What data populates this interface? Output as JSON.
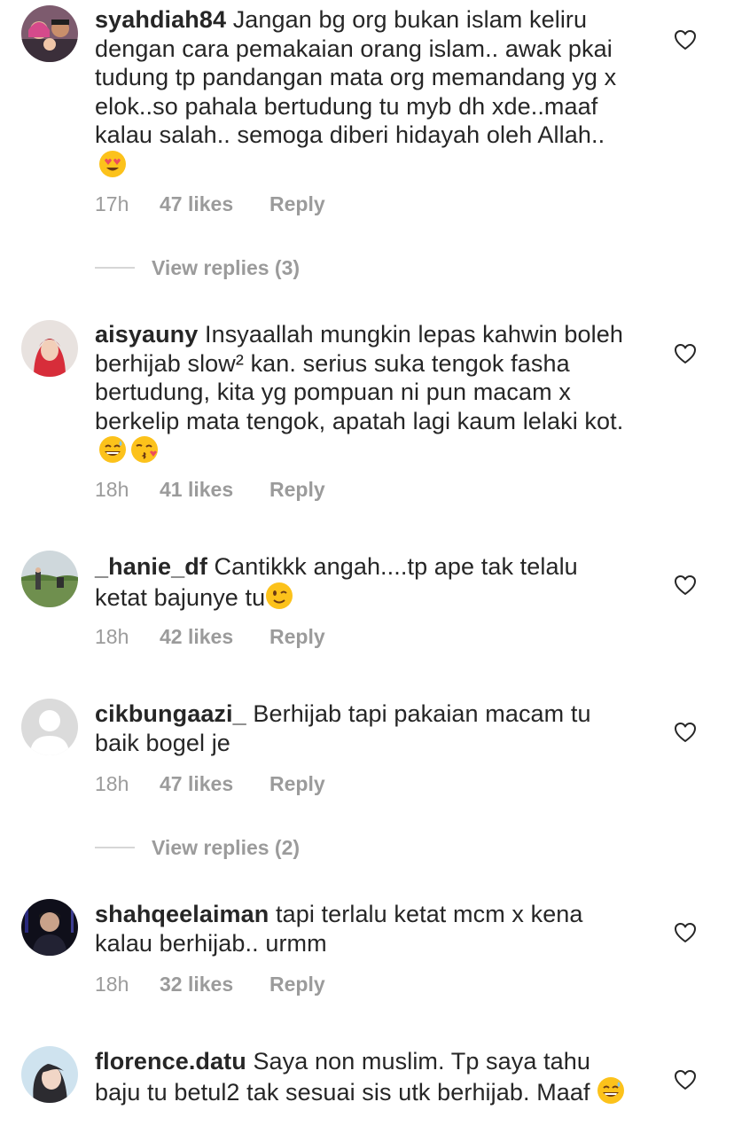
{
  "comments": [
    {
      "username": "syahdiah84",
      "text": "Jangan bg org bukan islam keliru dengan cara pemakaian orang islam.. awak pkai tudung tp pandangan mata org memandang yg x elok..so pahala bertudung tu myb dh xde..maaf kalau salah.. semoga diberi hidayah oleh Allah..",
      "emojis": [
        "😍"
      ],
      "time": "17h",
      "likes": "47 likes",
      "reply": "Reply",
      "view_replies": "View replies (3)"
    },
    {
      "username": "aisyauny",
      "text": "Insyaallah mungkin lepas kahwin boleh berhijab slow² kan. serius suka tengok fasha bertudung, kita yg pompuan ni pun macam x berkelip mata tengok, apatah lagi kaum lelaki kot.",
      "emojis": [
        "😅",
        "😘"
      ],
      "time": "18h",
      "likes": "41 likes",
      "reply": "Reply"
    },
    {
      "username": "_hanie_df",
      "text": "Cantikkk angah....tp ape tak telalu ketat bajunye tu",
      "emojis": [
        "😉"
      ],
      "time": "18h",
      "likes": "42 likes",
      "reply": "Reply"
    },
    {
      "username": "cikbungaazi_",
      "text": "Berhijab tapi pakaian macam tu baik bogel je",
      "emojis": [],
      "time": "18h",
      "likes": "47 likes",
      "reply": "Reply",
      "view_replies": "View replies (2)"
    },
    {
      "username": "shahqeelaiman",
      "text": "tapi terlalu ketat mcm x kena kalau berhijab.. urmm",
      "emojis": [],
      "time": "18h",
      "likes": "32 likes",
      "reply": "Reply"
    },
    {
      "username": "florence.datu",
      "text": "Saya non muslim. Tp saya tahu baju tu betul2 tak sesuai sis utk berhijab. Maaf",
      "emojis": [
        "😅"
      ],
      "time": "",
      "likes": "",
      "reply": ""
    }
  ],
  "icons": {
    "heart": "heart-outline-icon",
    "default_avatar": "default-avatar-icon"
  },
  "colors": {
    "text": "#262626",
    "meta": "#9b9b9b",
    "divider": "#d6d6d6"
  }
}
